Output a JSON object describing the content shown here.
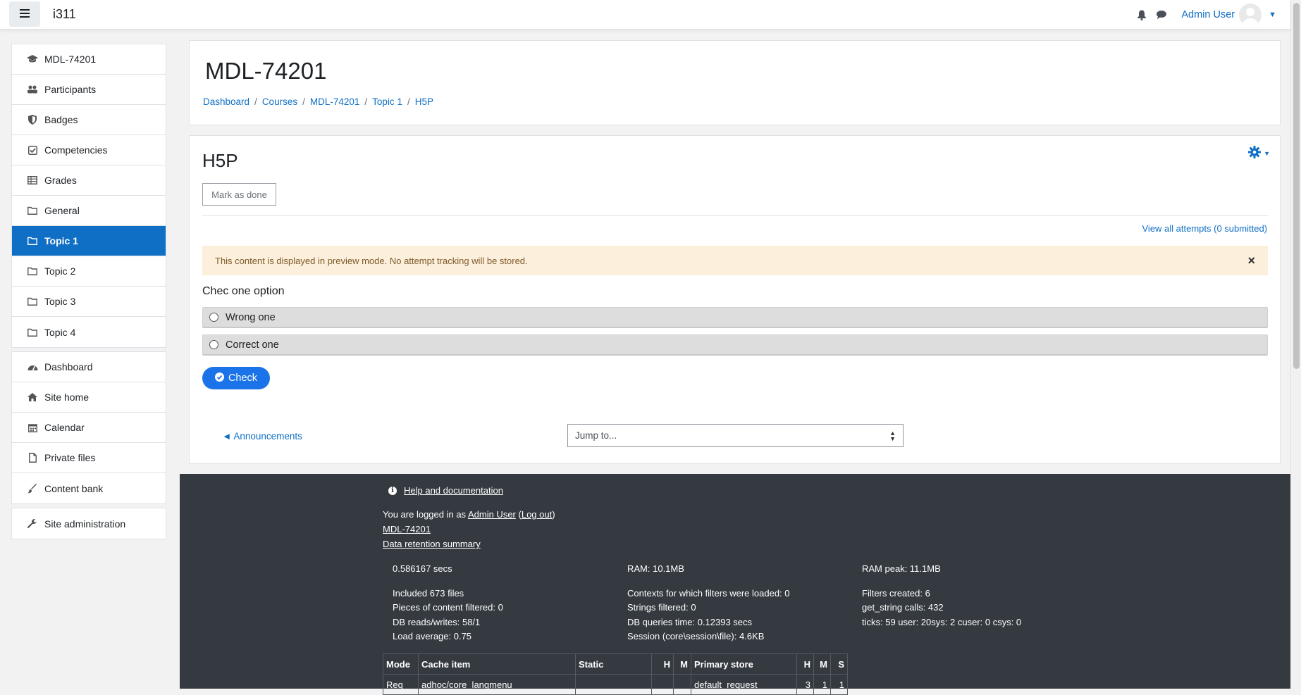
{
  "navbar": {
    "site_name": "i311",
    "user_name": "Admin User"
  },
  "sidebar": {
    "group1": [
      {
        "label": "MDL-74201",
        "icon": "graduation-cap-icon"
      },
      {
        "label": "Participants",
        "icon": "users-icon"
      },
      {
        "label": "Badges",
        "icon": "shield-icon"
      },
      {
        "label": "Competencies",
        "icon": "check-square-icon"
      },
      {
        "label": "Grades",
        "icon": "table-icon"
      },
      {
        "label": "General",
        "icon": "folder-icon"
      },
      {
        "label": "Topic 1",
        "icon": "folder-icon",
        "active": true
      },
      {
        "label": "Topic 2",
        "icon": "folder-icon"
      },
      {
        "label": "Topic 3",
        "icon": "folder-icon"
      },
      {
        "label": "Topic 4",
        "icon": "folder-icon"
      }
    ],
    "group2": [
      {
        "label": "Dashboard",
        "icon": "dashboard-icon"
      },
      {
        "label": "Site home",
        "icon": "home-icon"
      },
      {
        "label": "Calendar",
        "icon": "calendar-icon"
      },
      {
        "label": "Private files",
        "icon": "file-icon"
      },
      {
        "label": "Content bank",
        "icon": "brush-icon"
      }
    ],
    "group3": [
      {
        "label": "Site administration",
        "icon": "wrench-icon"
      }
    ]
  },
  "header": {
    "title": "MDL-74201",
    "breadcrumb": [
      "Dashboard",
      "Courses",
      "MDL-74201",
      "Topic 1",
      "H5P"
    ]
  },
  "activity": {
    "title": "H5P",
    "mark_done_label": "Mark as done",
    "attempts_link": "View all attempts (0 submitted)",
    "preview_notice": "This content is displayed in preview mode. No attempt tracking will be stored.",
    "close_symbol": "×",
    "question": "Chec one option",
    "options": [
      "Wrong one",
      "Correct one"
    ],
    "check_label": "Check",
    "prev_link": "◄ Announcements",
    "jump_placeholder": "Jump to..."
  },
  "footer": {
    "help_link": "Help and documentation",
    "logged_in_prefix": "You are logged in as ",
    "logged_in_user": "Admin User",
    "logout_label": "Log out",
    "course_link": "MDL-74201",
    "retention_link": "Data retention summary",
    "perf_col1": [
      "0.586167 secs",
      "",
      "Included 673 files",
      "Pieces of content filtered: 0",
      "DB reads/writes: 58/1",
      "Load average: 0.75"
    ],
    "perf_col2": [
      "RAM: 10.1MB",
      "",
      "Contexts for which filters were loaded: 0",
      "Strings filtered: 0",
      "DB queries time: 0.12393 secs",
      "Session (core\\session\\file): 4.6KB"
    ],
    "perf_col3": [
      "RAM peak: 11.1MB",
      "",
      "Filters created: 6",
      "get_string calls: 432",
      "ticks: 59 user: 20sys: 2 cuser: 0 csys: 0"
    ],
    "cache_table": {
      "headers": [
        "Mode",
        "Cache item",
        "Static",
        "H",
        "M",
        "Primary store",
        "H",
        "M",
        "S"
      ],
      "rows": [
        [
          "Req",
          "adhoc/core_langmenu",
          "",
          "",
          "",
          "default_request",
          "3",
          "1",
          "1"
        ]
      ]
    }
  },
  "colors": {
    "accent": "#0f6fc5",
    "footer_bg": "#343a40",
    "alert_bg": "#fcefdc",
    "check_button": "#1a73e8"
  }
}
